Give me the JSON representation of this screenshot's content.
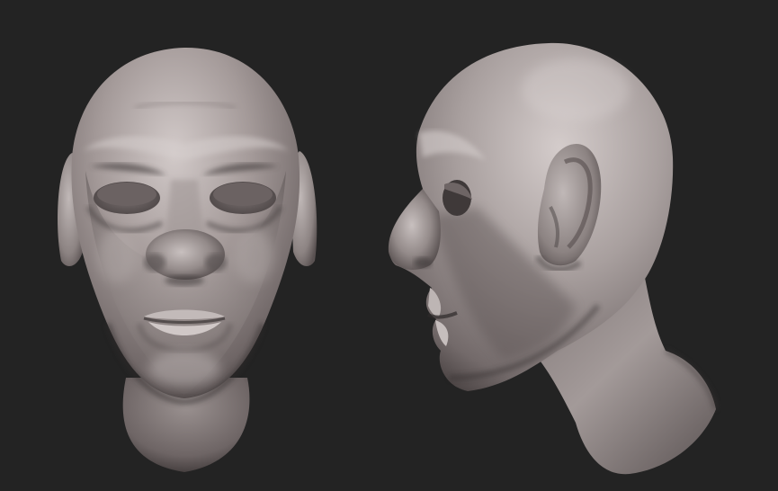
{
  "scene": {
    "background_color": "#232323",
    "material": "matcap-clay-grey",
    "skin_base_color": "#8a8080",
    "skin_highlight_color": "#cfc7c6",
    "skin_shadow_color": "#3a3434",
    "views": [
      {
        "name": "front-view"
      },
      {
        "name": "side-view"
      }
    ]
  }
}
